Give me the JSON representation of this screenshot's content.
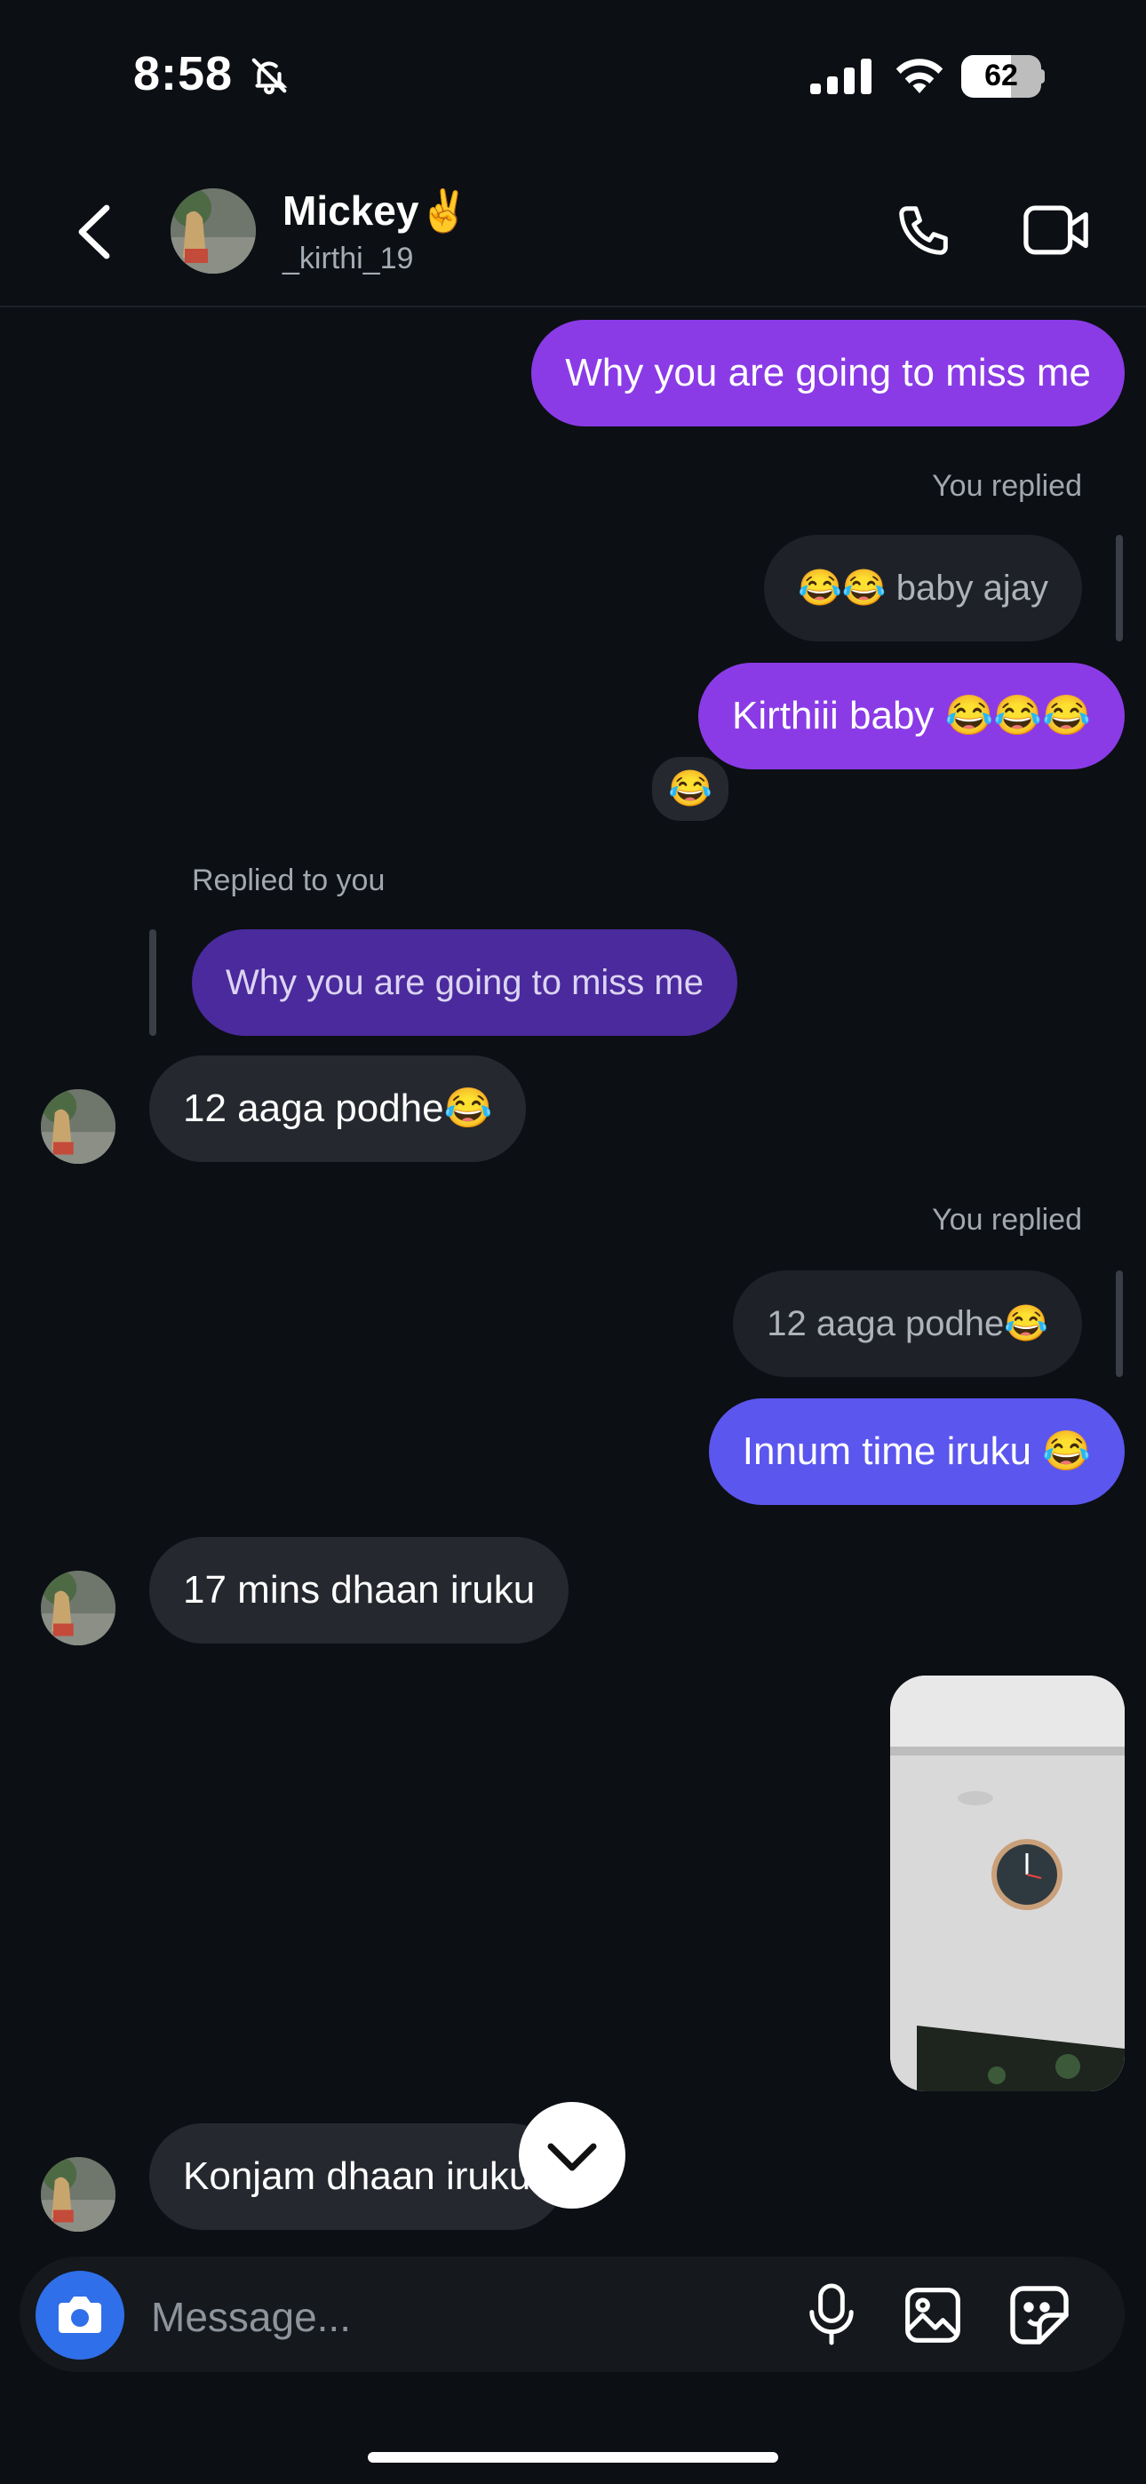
{
  "status": {
    "time": "8:58",
    "battery": "62"
  },
  "header": {
    "name": "Mickey✌️",
    "username": "_kirthi_19"
  },
  "messages": {
    "m1": "Why you are going to miss me",
    "you_replied_1": "You replied",
    "q1": "😂😂 baby ajay",
    "m2": "Kirthiii baby 😂😂😂",
    "reaction": "😂",
    "replied_to_you": "Replied to you",
    "q2": "Why you are going to miss me",
    "m3": "12 aaga podhe😂",
    "you_replied_2": "You replied",
    "q3": "12 aaga podhe😂",
    "m4": "Innum time iruku 😂",
    "m5": "17 mins dhaan iruku",
    "m6": "Konjam dhaan iruku"
  },
  "composer": {
    "placeholder": "Message..."
  },
  "colors": {
    "outgoing": "#8a3be6",
    "outgoing_alt": "#5b56ee",
    "incoming": "#25282e",
    "background": "#0c0f14",
    "camera": "#2f6fe9"
  },
  "icons": [
    "bell-slash-icon",
    "signal-icon",
    "wifi-icon",
    "battery-icon",
    "back-chevron-icon",
    "phone-icon",
    "video-icon",
    "chevron-down-icon",
    "camera-icon",
    "microphone-icon",
    "gallery-icon",
    "sticker-icon"
  ]
}
